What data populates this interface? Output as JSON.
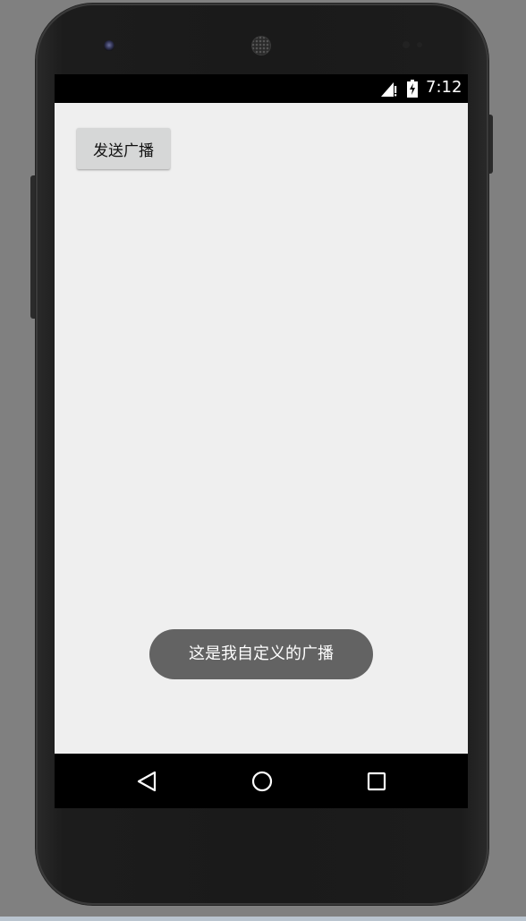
{
  "status_bar": {
    "time": "7:12",
    "signal_icon": "cell-signal-no-data-icon",
    "battery_icon": "battery-charging-icon"
  },
  "main": {
    "send_button_label": "发送广播",
    "background_color": "#efefef"
  },
  "toast": {
    "message": "这是我自定义的广播",
    "background_color": "#636363"
  },
  "nav_bar": {
    "back_icon": "back-triangle-icon",
    "home_icon": "home-circle-icon",
    "recents_icon": "recents-square-icon"
  }
}
